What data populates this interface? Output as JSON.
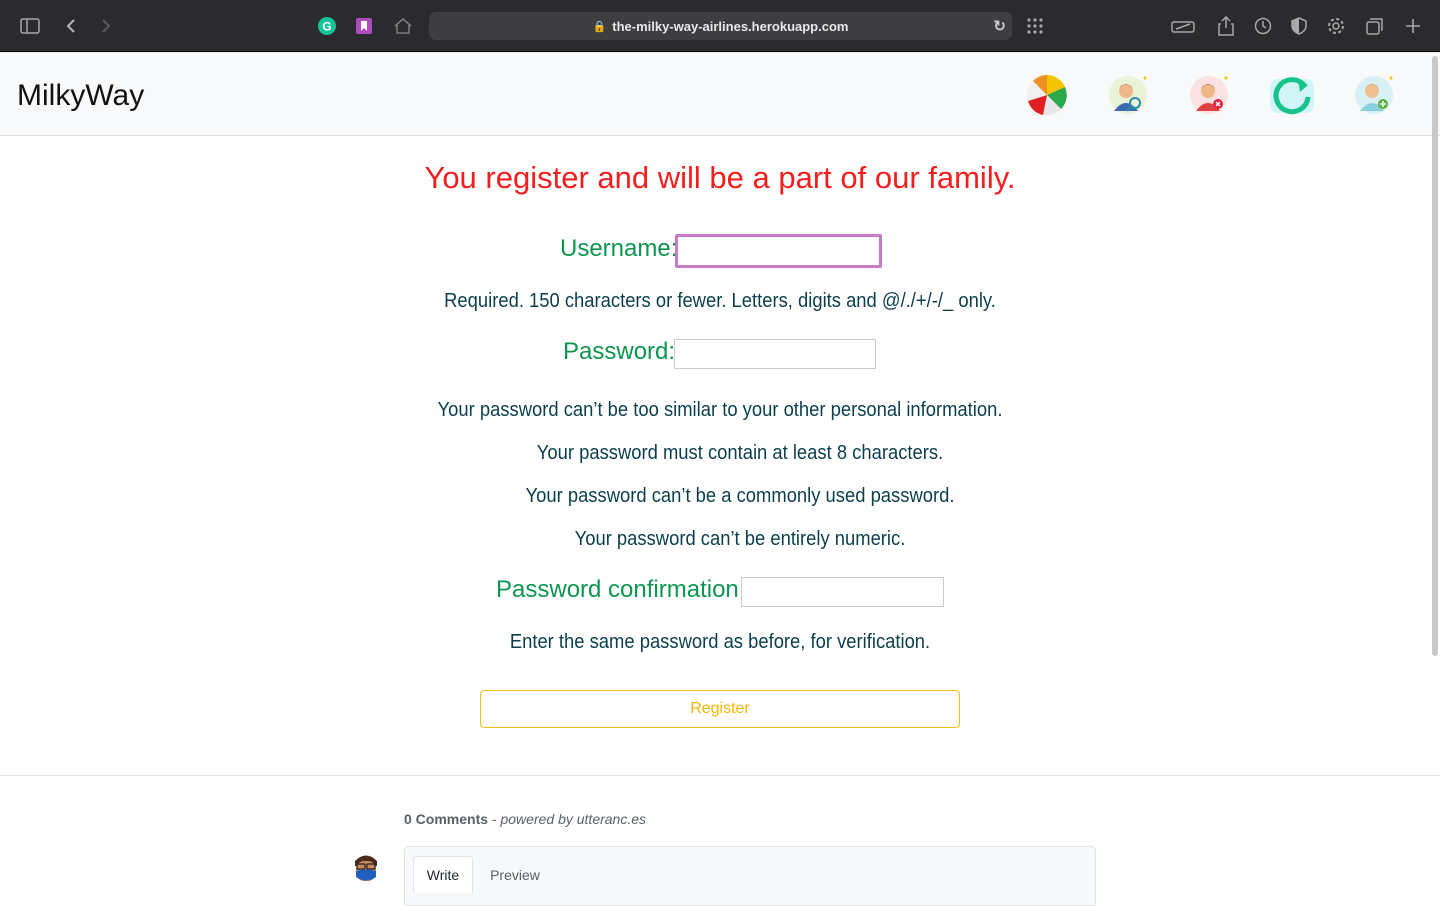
{
  "browser": {
    "url": "the-milky-way-airlines.herokuapp.com"
  },
  "navbar": {
    "brand": "MilkyWay"
  },
  "form": {
    "headline": "You register and will be a part of our family.",
    "username_label": "Username:",
    "username_value": "",
    "username_help": "Required. 150 characters or fewer. Letters, digits and @/./+/-/_ only.",
    "password_label": "Password:",
    "password_help": [
      "Your password can’t be too similar to your other personal information.",
      "Your password must contain at least 8 characters.",
      "Your password can’t be a commonly used password.",
      "Your password can’t be entirely numeric."
    ],
    "confirm_label": "Password confirmation:",
    "confirm_help": "Enter the same password as before, for verification.",
    "register_label": "Register"
  },
  "comments": {
    "count_label": "0 Comments",
    "powered_by": "powered by utteranc.es",
    "tabs": [
      "Write",
      "Preview"
    ]
  },
  "colors": {
    "headline": "#f41e1e",
    "label": "#0d9650",
    "help": "#0b3f4d",
    "register": "#f4b400"
  }
}
